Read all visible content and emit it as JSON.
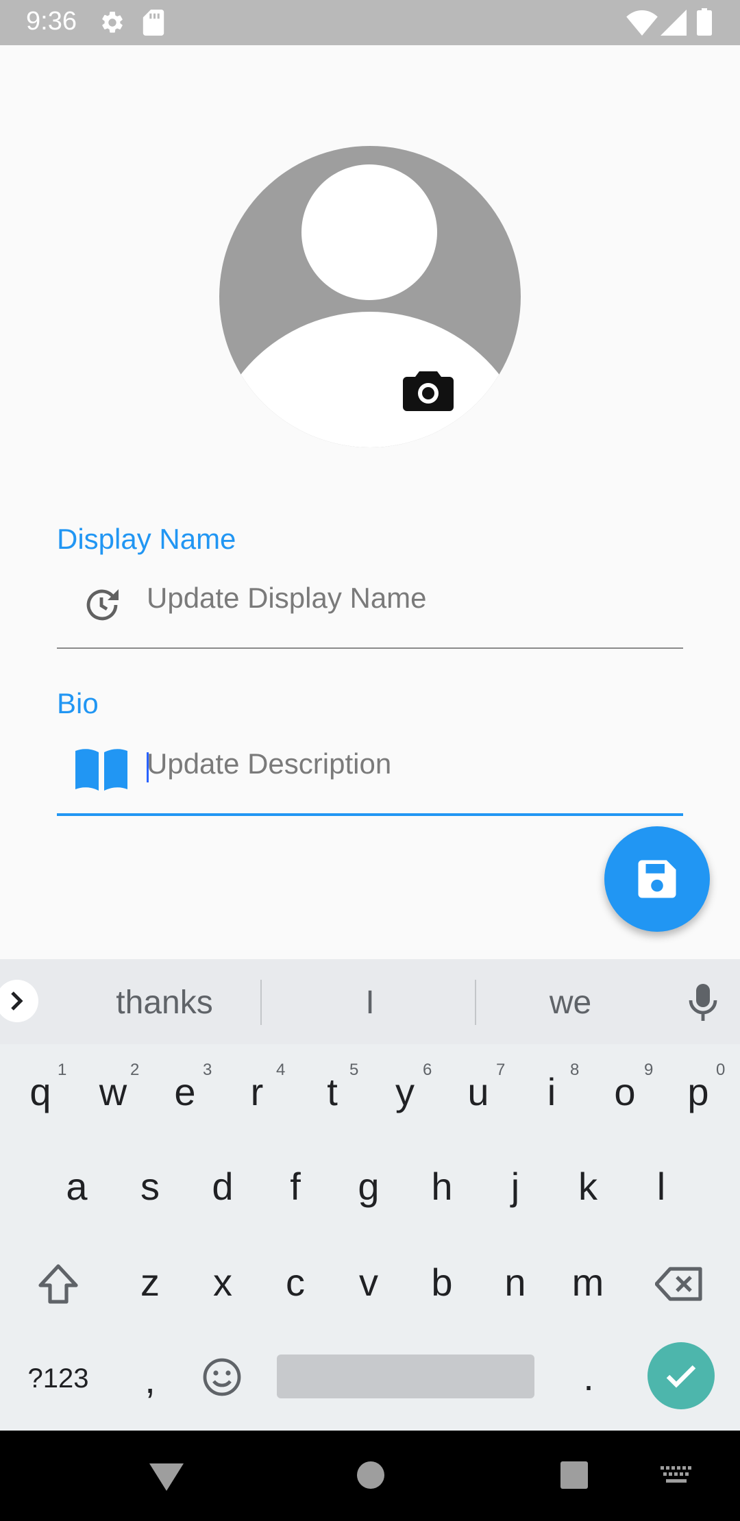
{
  "status_bar": {
    "time": "9:36",
    "icons": [
      "gear-icon",
      "sd-card-icon",
      "wifi-icon",
      "cell-signal-icon",
      "battery-icon"
    ]
  },
  "profile": {
    "avatar_icon": "default-person-icon",
    "camera_icon": "camera-icon"
  },
  "form": {
    "display_name": {
      "label": "Display Name",
      "placeholder": "Update Display Name",
      "value": "",
      "icon": "history-icon"
    },
    "bio": {
      "label": "Bio",
      "placeholder": "Update Description",
      "value": "",
      "icon": "book-icon"
    }
  },
  "save_button": {
    "icon": "floppy-save-icon"
  },
  "keyboard": {
    "suggestions": [
      "thanks",
      "I",
      "we"
    ],
    "row1": [
      "q",
      "w",
      "e",
      "r",
      "t",
      "y",
      "u",
      "i",
      "o",
      "p"
    ],
    "row1_hints": [
      "1",
      "2",
      "3",
      "4",
      "5",
      "6",
      "7",
      "8",
      "9",
      "0"
    ],
    "row2": [
      "a",
      "s",
      "d",
      "f",
      "g",
      "h",
      "j",
      "k",
      "l"
    ],
    "row3": [
      "z",
      "x",
      "c",
      "v",
      "b",
      "n",
      "m"
    ],
    "symbols_key": "?123",
    "comma_key": ",",
    "period_key": "."
  },
  "colors": {
    "accent": "#2196f3",
    "status_bar": "#b9b9b9",
    "enter_key": "#4db6ac"
  }
}
